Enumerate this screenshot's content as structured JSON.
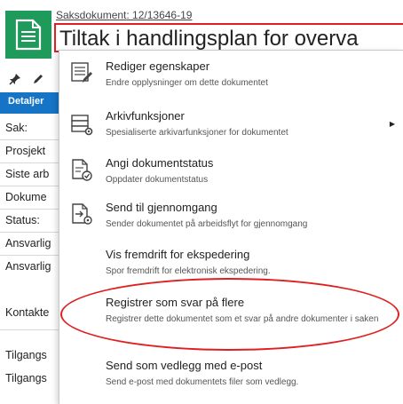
{
  "document": {
    "subtitle": "Saksdokument: 12/13646-19",
    "title": "Tiltak i handlingsplan for overva",
    "icon": "document-icon",
    "brand_color": "#1f9a5b",
    "highlight_color": "#e02020"
  },
  "toolbar": {
    "icons": [
      "pin-icon",
      "edit-icon"
    ]
  },
  "tabs": {
    "active_label": "Detaljer",
    "accent": "#1674c6"
  },
  "fields": [
    {
      "label": "Sak:"
    },
    {
      "label": "Prosjekt"
    },
    {
      "label": "Siste arb"
    },
    {
      "label": "Dokume"
    },
    {
      "label": "Status:"
    },
    {
      "label": "Ansvarlig"
    },
    {
      "label": "Ansvarlig"
    },
    {
      "label": "Kontakte"
    },
    {
      "label": "Tilgangs"
    },
    {
      "label": "Tilgangs"
    }
  ],
  "menu": {
    "items": [
      {
        "label": "Rediger egenskaper",
        "desc": "Endre opplysninger om dette dokumentet",
        "icon": "edit-properties-icon"
      },
      {
        "label": "Arkivfunksjoner",
        "desc": "Spesialiserte arkivarfunksjoner for dokumentet",
        "icon": "archive-functions-icon",
        "submenu": "▶"
      },
      {
        "label": "Angi dokumentstatus",
        "desc": "Oppdater dokumentstatus",
        "icon": "document-status-icon"
      },
      {
        "label": "Send til gjennomgang",
        "desc": "Sender dokumentet på arbeidsflyt for gjennomgang",
        "icon": "send-review-icon"
      },
      {
        "label": "Vis fremdrift for ekspedering",
        "desc": "Spor fremdrift for elektronisk ekspedering."
      },
      {
        "label": "Registrer som svar på flere",
        "desc": "Registrer dette dokumentet som et svar på andre dokumenter i saken"
      },
      {
        "label": "Send som vedlegg med e-post",
        "desc": "Send e-post med dokumentets filer som vedlegg."
      }
    ]
  }
}
